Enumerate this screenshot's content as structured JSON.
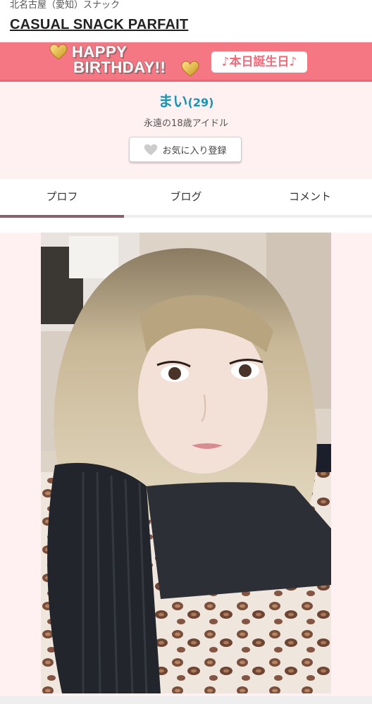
{
  "header": {
    "area": "北名古屋（愛知）スナック",
    "shop_name": "CASUAL SNACK PARFAIT"
  },
  "birthday_banner": {
    "line1": "HAPPY",
    "line2": "BIRTHDAY!!",
    "badge": "♪本日誕生日♪",
    "background_color": "#f47783"
  },
  "profile": {
    "name": "まい",
    "age": "(29)",
    "catchphrase": "永遠の18歳アイドル",
    "favorite_button": "お気に入り登録",
    "name_color": "#1a95b5"
  },
  "tabs": [
    {
      "label": "プロフ",
      "active": true
    },
    {
      "label": "ブログ",
      "active": false
    },
    {
      "label": "コメント",
      "active": false
    }
  ]
}
